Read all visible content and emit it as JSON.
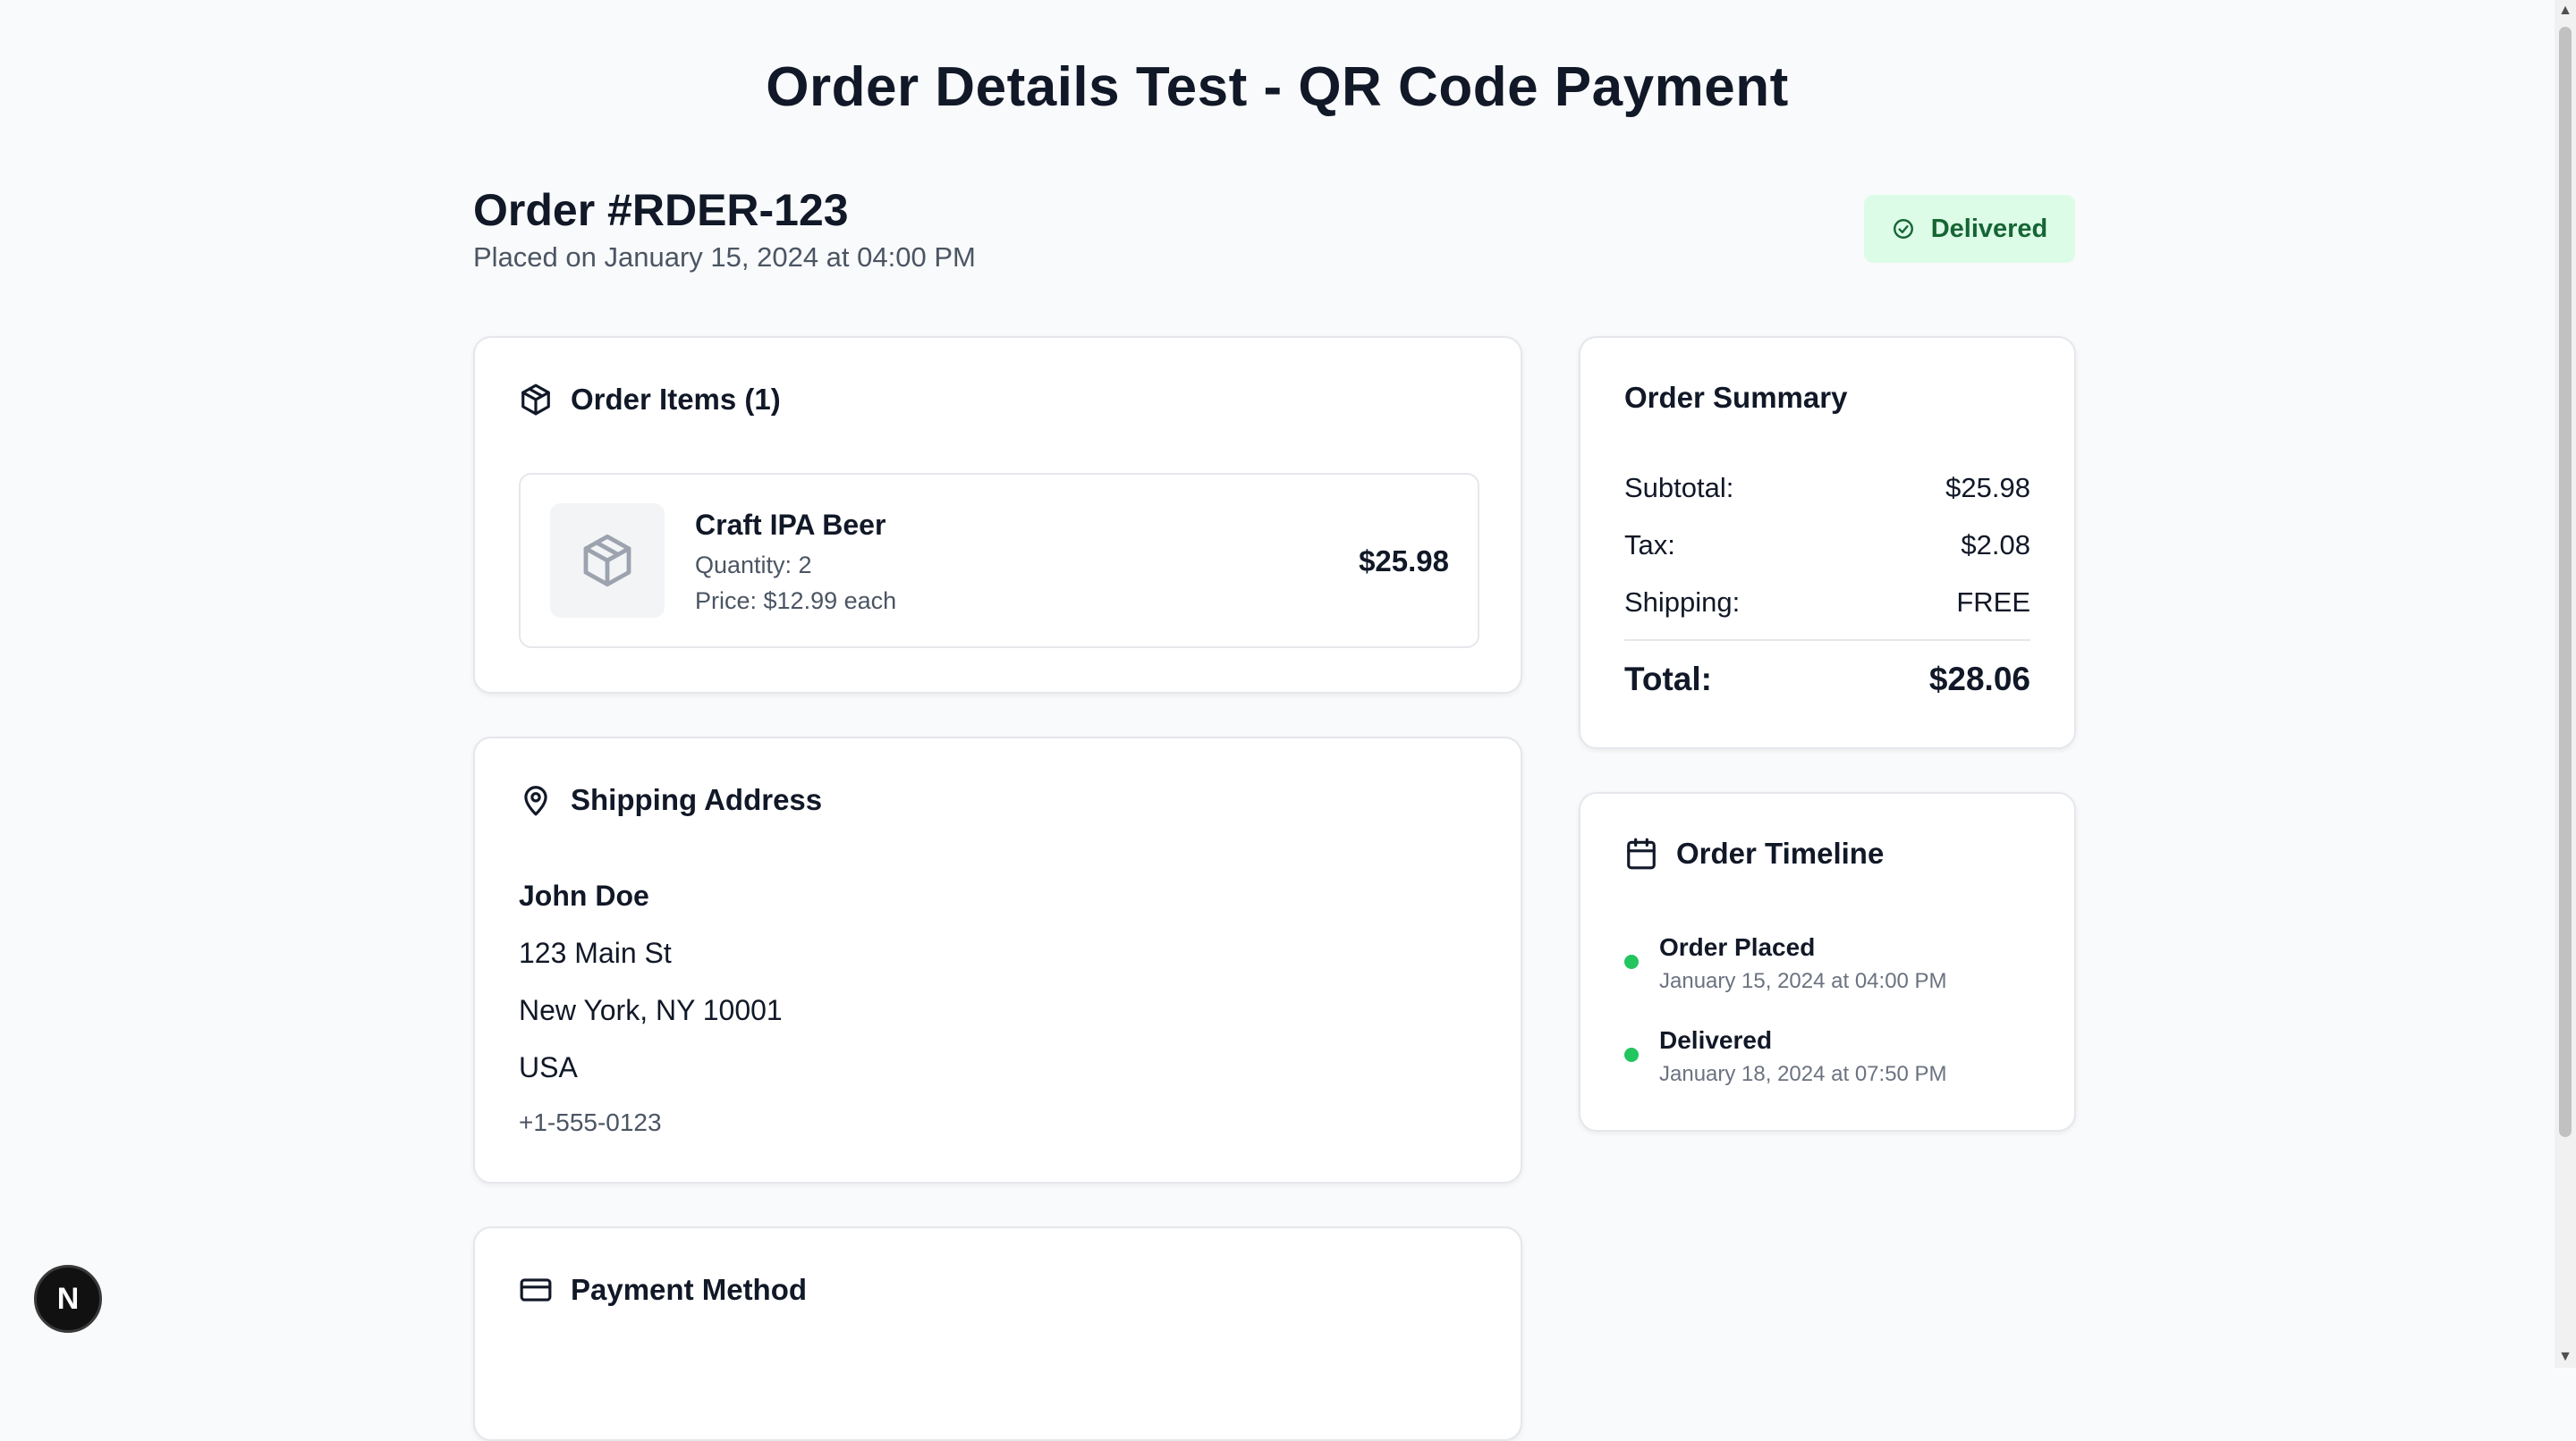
{
  "page": {
    "title": "Order Details Test - QR Code Payment"
  },
  "order": {
    "number": "Order #RDER-123",
    "placed": "Placed on January 15, 2024 at 04:00 PM",
    "status": "Delivered"
  },
  "items_card": {
    "title": "Order Items (1)",
    "items": [
      {
        "name": "Craft IPA Beer",
        "quantity": "Quantity: 2",
        "price": "Price: $12.99 each",
        "total": "$25.98"
      }
    ]
  },
  "shipping": {
    "title": "Shipping Address",
    "name": "John Doe",
    "street": "123 Main St",
    "city": "New York, NY 10001",
    "country": "USA",
    "phone": "+1-555-0123"
  },
  "payment": {
    "title": "Payment Method"
  },
  "summary": {
    "title": "Order Summary",
    "rows": [
      {
        "label": "Subtotal:",
        "value": "$25.98"
      },
      {
        "label": "Tax:",
        "value": "$2.08"
      },
      {
        "label": "Shipping:",
        "value": "FREE"
      }
    ],
    "total_label": "Total:",
    "total_value": "$28.06"
  },
  "timeline": {
    "title": "Order Timeline",
    "events": [
      {
        "title": "Order Placed",
        "date": "January 15, 2024 at 04:00 PM"
      },
      {
        "title": "Delivered",
        "date": "January 18, 2024 at 07:50 PM"
      }
    ]
  },
  "dev_badge": {
    "letter": "N"
  },
  "colors": {
    "accent_green": "#22c55e",
    "badge_bg": "#dcfce7",
    "badge_text": "#166534"
  },
  "icons": [
    "check-circle-icon",
    "package-icon",
    "map-pin-icon",
    "credit-card-icon",
    "calendar-icon"
  ]
}
